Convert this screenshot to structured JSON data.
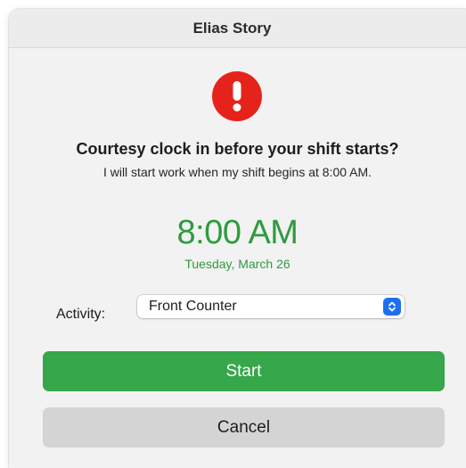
{
  "window": {
    "title": "Elias Story"
  },
  "alert": {
    "icon": "exclamation-icon",
    "headline": "Courtesy clock in before your shift starts?",
    "message": "I will start work when my shift begins at 8:00 AM."
  },
  "shift": {
    "time": "8:00 AM",
    "date": "Tuesday, March 26"
  },
  "activity": {
    "label": "Activity:",
    "selected": "Front Counter"
  },
  "buttons": {
    "start_label": "Start",
    "cancel_label": "Cancel"
  },
  "colors": {
    "accent_green": "#36a74a",
    "time_green": "#2e9b3e",
    "alert_red": "#e6231b",
    "select_blue": "#1e6ff0"
  }
}
